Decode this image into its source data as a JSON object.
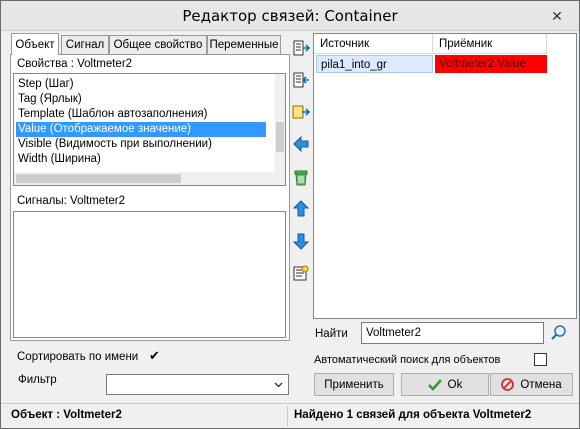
{
  "window": {
    "title": "Редактор связей: Container",
    "close_glyph": "✕"
  },
  "tabs": [
    {
      "label": "Объект"
    },
    {
      "label": "Сигнал"
    },
    {
      "label": "Общее свойство"
    },
    {
      "label": "Переменные"
    }
  ],
  "left": {
    "properties_label": "Свойства : Voltmeter2",
    "properties": [
      {
        "label": "Step  (Шаг)"
      },
      {
        "label": "Tag  (Ярлык)"
      },
      {
        "label": "Template  (Шаблон автозаполнения)"
      },
      {
        "label": "Value  (Отображаемое значение)"
      },
      {
        "label": "Visible  (Видимость при выполнении)"
      },
      {
        "label": "Width  (Ширина)"
      }
    ],
    "selected_index": 3,
    "signals_label": "Сигналы: Voltmeter2",
    "sort_label": "Сортировать по имени",
    "sort_checked": "✔",
    "filter_label": "Фильтр",
    "filter_value": ""
  },
  "toolbar_icons": [
    {
      "name": "insert-link-icon"
    },
    {
      "name": "insert-link-2-icon"
    },
    {
      "name": "link-right-icon"
    },
    {
      "name": "arrow-left-icon"
    },
    {
      "name": "delete-icon"
    },
    {
      "name": "move-up-icon"
    },
    {
      "name": "move-down-icon"
    },
    {
      "name": "properties-icon"
    }
  ],
  "links_table": {
    "headers": [
      "Источник",
      "Приёмник"
    ],
    "rows": [
      {
        "source": "pila1_into_gr",
        "target": "Voltmeter2.Value"
      }
    ],
    "target_highlight_color": "#ff0000"
  },
  "find": {
    "label": "Найти",
    "value": "Voltmeter2",
    "auto_search_label": "Автоматический  поиск  для  объектов",
    "auto_search_checked": ""
  },
  "buttons": {
    "apply": "Применить",
    "ok": "Ok",
    "cancel": "Отмена"
  },
  "status": {
    "left": "Объект : Voltmeter2",
    "right": "Найдено  1  связей для объекта Voltmeter2"
  }
}
